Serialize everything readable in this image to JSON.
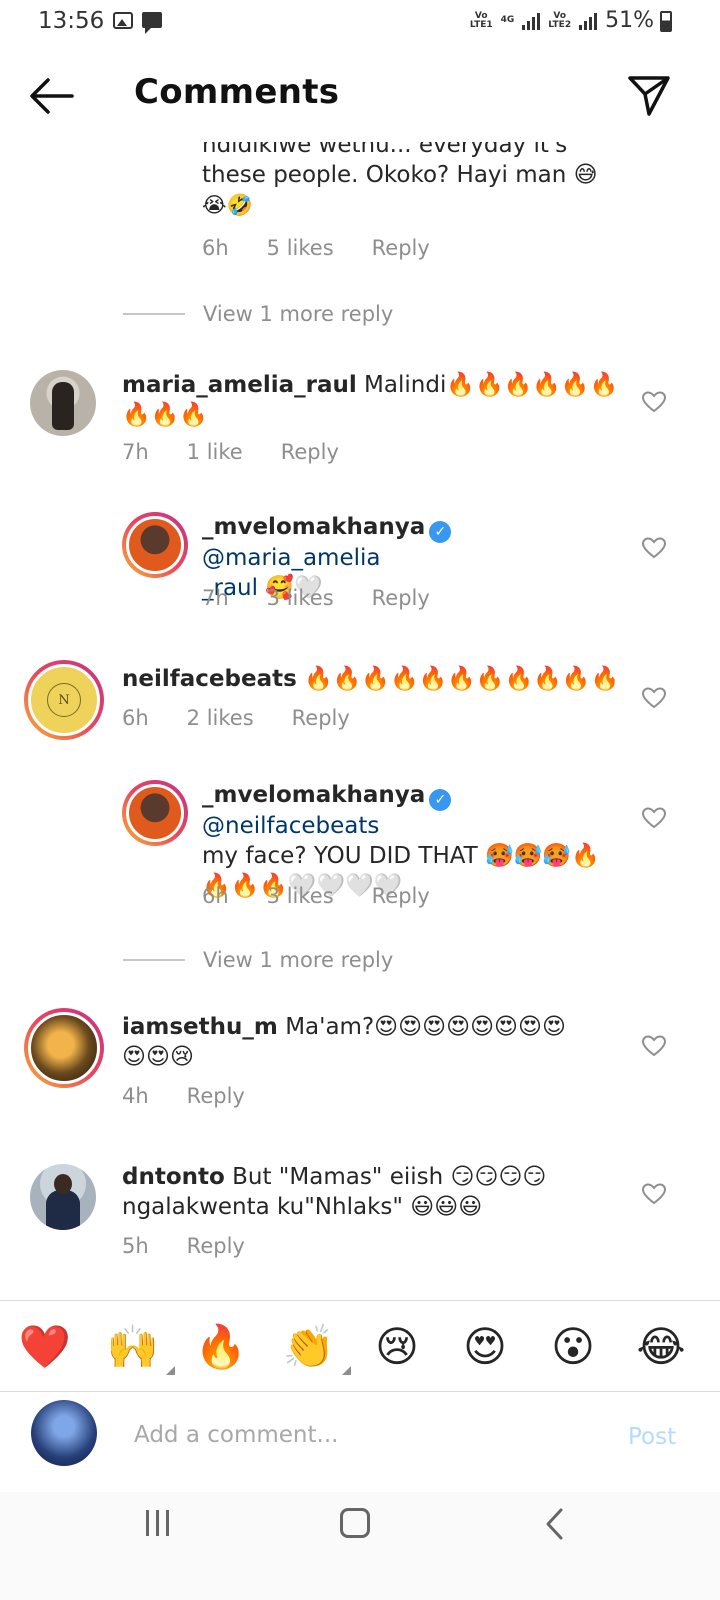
{
  "status_bar": {
    "time": "13:56",
    "net1": "Vo\nLTE1",
    "net_4g": "4G",
    "net2": "Vo\nLTE2",
    "battery": "51%"
  },
  "header": {
    "title": "Comments"
  },
  "partial_comment": {
    "text_line1": "ndidikiwe wethu... everyday it's",
    "text_line2": "these people. Okoko? Hayi man 😅",
    "text_line3": "😭🤣",
    "time": "6h",
    "likes": "5 likes",
    "reply": "Reply"
  },
  "view_more_1": "View 1 more reply",
  "view_more_2": "View 1 more reply",
  "comments": [
    {
      "user": "maria_amelia_raul",
      "text": "Malindi🔥🔥🔥🔥🔥🔥",
      "text2": "🔥🔥🔥",
      "time": "7h",
      "likes": "1 like",
      "reply": "Reply"
    },
    {
      "user": "_mvelomakhanya",
      "mention": "@maria_amelia",
      "mention2": "_raul",
      "text2": "🥰🤍",
      "time": "7h",
      "likes": "3 likes",
      "reply": "Reply"
    },
    {
      "user": "neilfacebeats",
      "text": "🔥🔥🔥🔥🔥🔥🔥🔥🔥🔥🔥",
      "time": "6h",
      "likes": "2 likes",
      "reply": "Reply",
      "avatar_letter": "N"
    },
    {
      "user": "_mvelomakhanya",
      "mention": "@neilfacebeats",
      "text": "my face? YOU DID THAT 🥵🥵🥵🔥",
      "text2": "🔥🔥🔥🤍🤍🤍🤍",
      "time": "6h",
      "likes": "3 likes",
      "reply": "Reply"
    },
    {
      "user": "iamsethu_m",
      "text": "Ma'am?😍😍😍😍😍😍😍😍",
      "text2": "😍😍😢",
      "time": "4h",
      "reply": "Reply"
    },
    {
      "user": "dntonto",
      "text": "But \"Mamas\" eiish 😏😏😏😏",
      "text2": "ngalakwenta ku\"Nhlaks\" 😃😃😃",
      "time": "5h",
      "reply": "Reply"
    }
  ],
  "reactions": [
    "❤️",
    "🙌",
    "🔥",
    "👏",
    "😢",
    "😍",
    "😮",
    "😂"
  ],
  "composer": {
    "placeholder": "Add a comment...",
    "post": "Post"
  }
}
